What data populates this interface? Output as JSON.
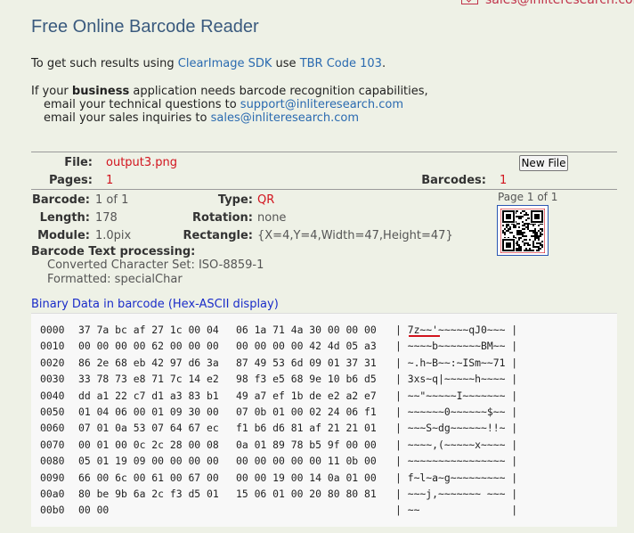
{
  "top_email": "sales@inliteresearch.com",
  "title": "Free Online Barcode Reader",
  "intro": {
    "line1_pre": "To get such results using ",
    "line1_link1": "ClearImage SDK",
    "line1_mid": " use ",
    "line1_link2": "TBR Code 103",
    "line1_post": ".",
    "line2_pre": "If your ",
    "line2_bold": "business",
    "line2_post": " application needs barcode recognition capabilities,",
    "line3_pre": "email your technical questions to ",
    "line3_link": "support@inliteresearch.com",
    "line4_pre": "email your sales inquiries to ",
    "line4_link": "sales@inliteresearch.com"
  },
  "file": {
    "file_label": "File:",
    "file_value": "output3.png",
    "pages_label": "Pages:",
    "pages_value": "1",
    "barcodes_label": "Barcodes:",
    "barcodes_value": "1",
    "new_file_button": "New File"
  },
  "barcode": {
    "barcode_label": "Barcode:",
    "barcode_value": "1 of 1",
    "type_label": "Type:",
    "type_value": "QR",
    "length_label": "Length:",
    "length_value": "178",
    "rotation_label": "Rotation:",
    "rotation_value": "none",
    "module_label": "Module:",
    "module_value": "1.0pix",
    "rectangle_label": "Rectangle:",
    "rectangle_value": "{X=4,Y=4,Width=47,Height=47}",
    "page_info": "Page 1 of 1"
  },
  "processing": {
    "title": "Barcode Text processing:",
    "line1": "Converted Character Set: ISO-8859-1",
    "line2": "Formatted: specialChar"
  },
  "binary": {
    "title": "Binary Data in barcode (Hex-ASCII display)",
    "rows": [
      {
        "offset": "0000",
        "hex1": "37 7a bc af 27 1c 00 04",
        "hex2": "06 1a 71 4a 30 00 00 00",
        "ascii": "| 7z~~'~~~~~qJ0~~~ |"
      },
      {
        "offset": "0010",
        "hex1": "00 00 00 00 62 00 00 00",
        "hex2": "00 00 00 00 42 4d 05 a3",
        "ascii": "| ~~~~b~~~~~~~BM~~ |"
      },
      {
        "offset": "0020",
        "hex1": "86 2e 68 eb 42 97 d6 3a",
        "hex2": "87 49 53 6d 09 01 37 31",
        "ascii": "| ~.h~B~~:~ISm~~71 |"
      },
      {
        "offset": "0030",
        "hex1": "33 78 73 e8 71 7c 14 e2",
        "hex2": "98 f3 e5 68 9e 10 b6 d5",
        "ascii": "| 3xs~q|~~~~~h~~~~ |"
      },
      {
        "offset": "0040",
        "hex1": "dd a1 22 c7 d1 a3 83 b1",
        "hex2": "49 a7 ef 1b de e2 a2 e7",
        "ascii": "| ~~\"~~~~~I~~~~~~~ |"
      },
      {
        "offset": "0050",
        "hex1": "01 04 06 00 01 09 30 00",
        "hex2": "07 0b 01 00 02 24 06 f1",
        "ascii": "| ~~~~~~0~~~~~~$~~ |"
      },
      {
        "offset": "0060",
        "hex1": "07 01 0a 53 07 64 67 ec",
        "hex2": "f1 b6 d6 81 af 21 21 01",
        "ascii": "| ~~~S~dg~~~~~~!!~ |"
      },
      {
        "offset": "0070",
        "hex1": "00 01 00 0c 2c 28 00 08",
        "hex2": "0a 01 89 78 b5 9f 00 00",
        "ascii": "| ~~~~,(~~~~~x~~~~ |"
      },
      {
        "offset": "0080",
        "hex1": "05 01 19 09 00 00 00 00",
        "hex2": "00 00 00 00 00 11 0b 00",
        "ascii": "| ~~~~~~~~~~~~~~~~ |"
      },
      {
        "offset": "0090",
        "hex1": "66 00 6c 00 61 00 67 00",
        "hex2": "00 00 19 00 14 0a 01 00",
        "ascii": "| f~l~a~g~~~~~~~~~ |"
      },
      {
        "offset": "00a0",
        "hex1": "80 be 9b 6a 2c f3 d5 01",
        "hex2": "15 06 01 00 20 80 80 81",
        "ascii": "| ~~~j,~~~~~~~ ~~~ |"
      },
      {
        "offset": "00b0",
        "hex1": "00 00",
        "hex2": "",
        "ascii": "| ~~               |"
      }
    ]
  }
}
